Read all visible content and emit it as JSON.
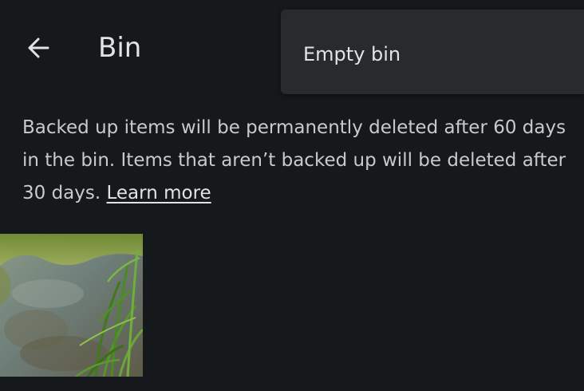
{
  "header": {
    "title": "Bin",
    "back_icon": "arrow-back-icon"
  },
  "menu": {
    "items": [
      {
        "label": "Empty bin"
      }
    ]
  },
  "info": {
    "text": "Backed up items will be permanently deleted after 60 days in the bin. Items that aren’t backed up will be deleted after 30 days. ",
    "link": "Learn more"
  },
  "photos": [
    {
      "description_icon": "photo-thumbnail"
    }
  ],
  "colors": {
    "background": "#15191c",
    "menu_surface": "#282b2e",
    "text_primary": "#e3e3e3",
    "text_secondary": "#c9cacc"
  }
}
